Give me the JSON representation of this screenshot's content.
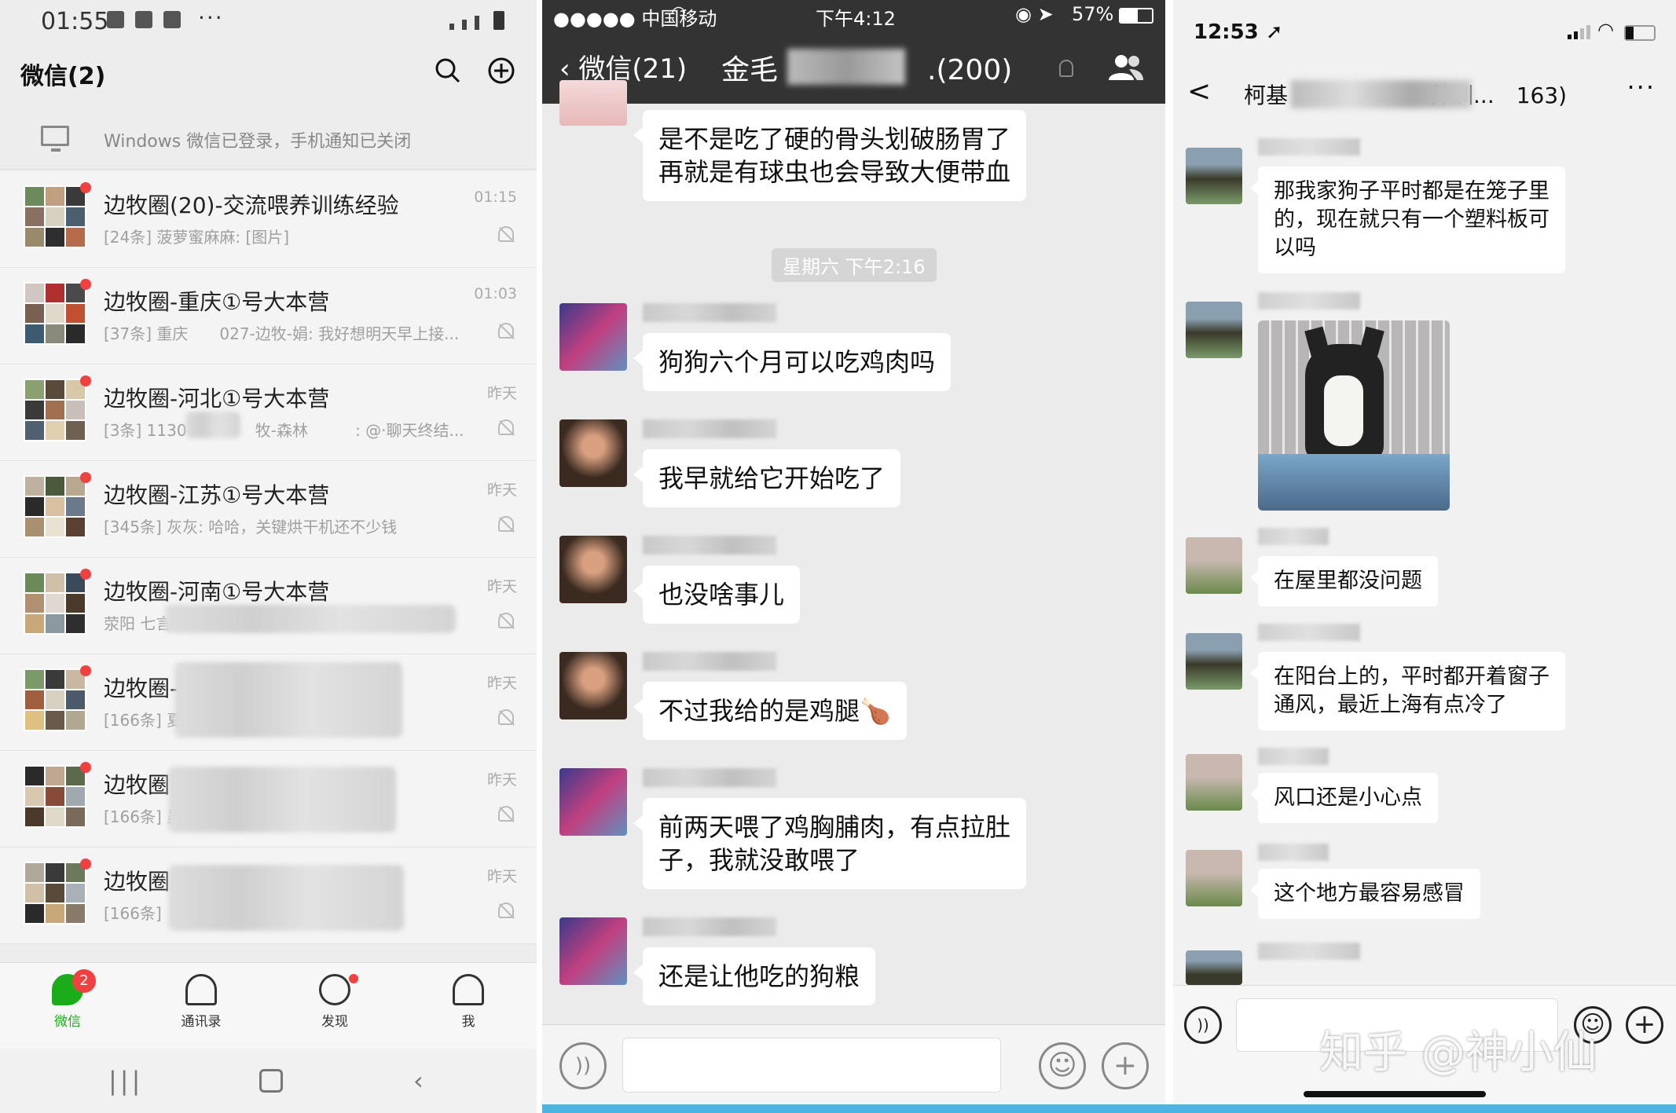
{
  "panel_left": {
    "status": {
      "time": "01:55",
      "dots": "···"
    },
    "header": {
      "title": "微信(2)"
    },
    "notice": "Windows 微信已登录，手机通知已关闭",
    "chats": [
      {
        "name": "边牧圈(20)-交流喂养训练经验",
        "preview": "[24条] 菠萝蜜麻麻: [图片]",
        "time": "01:15"
      },
      {
        "name": "边牧圈-重庆①号大本营",
        "preview": "[37条] 重庆　　027-边牧-娟: 我好想明天早上接...",
        "time": "01:03"
      },
      {
        "name": "边牧圈-河北①号大本营",
        "preview": "[3条] 1130-　　　　牧-森林　　　: @·聊天终结...",
        "time": "昨天"
      },
      {
        "name": "边牧圈-江苏①号大本营",
        "preview": "[345条] 灰灰: 哈哈，关键烘干机还不少钱",
        "time": "昨天"
      },
      {
        "name": "边牧圈-河南①号大本营",
        "preview": "荥阳 七言",
        "time": "昨天"
      },
      {
        "name": "边牧圈-",
        "preview": "[166条] 夏",
        "time": "昨天"
      },
      {
        "name": "边牧圈",
        "preview": "[166条] 虽",
        "time": "昨天"
      },
      {
        "name": "边牧圈",
        "preview": "[166条]",
        "time": "昨天"
      }
    ],
    "tabs": [
      {
        "label": "微信",
        "badge": "2"
      },
      {
        "label": "通讯录"
      },
      {
        "label": "发现"
      },
      {
        "label": "我"
      }
    ]
  },
  "panel_middle": {
    "status": {
      "carrier": "●●●●● 中国移动",
      "time": "下午4:12",
      "battery": "57%"
    },
    "nav": {
      "back": "微信(21)",
      "title_start": "金毛",
      "title_end": ".(200)"
    },
    "timestamp": "星期六 下午2:16",
    "messages": [
      {
        "text_lines": [
          "是不是吃了硬的骨头划破肠胃了",
          "再就是有球虫也会导致大便带血"
        ]
      },
      {
        "text_lines": [
          "狗狗六个月可以吃鸡肉吗"
        ]
      },
      {
        "text_lines": [
          "我早就给它开始吃了"
        ]
      },
      {
        "text_lines": [
          "也没啥事儿"
        ]
      },
      {
        "text_lines": [
          "不过我给的是鸡腿🍗"
        ]
      },
      {
        "text_lines": [
          "前两天喂了鸡胸脯肉，有点拉肚",
          "子，我就没敢喂了"
        ]
      },
      {
        "text_lines": [
          "还是让他吃的狗粮"
        ]
      }
    ]
  },
  "panel_right": {
    "status": {
      "time": "12:53"
    },
    "nav": {
      "back": "<",
      "title_start": "柯基",
      "title_end": "养训...　163)",
      "more": "···"
    },
    "messages": [
      {
        "text_lines": [
          "那我家狗子平时都是在笼子里",
          "的，现在就只有一个塑料板可",
          "以吗"
        ]
      },
      {
        "image": "dog-in-cage-photo"
      },
      {
        "text_lines": [
          "在屋里都没问题"
        ]
      },
      {
        "text_lines": [
          "在阳台上的，平时都开着窗子",
          "通风，最近上海有点冷了"
        ]
      },
      {
        "text_lines": [
          "风口还是小心点"
        ]
      },
      {
        "text_lines": [
          "这个地方最容易感冒"
        ]
      }
    ],
    "watermark": "知乎 @神小仙"
  }
}
